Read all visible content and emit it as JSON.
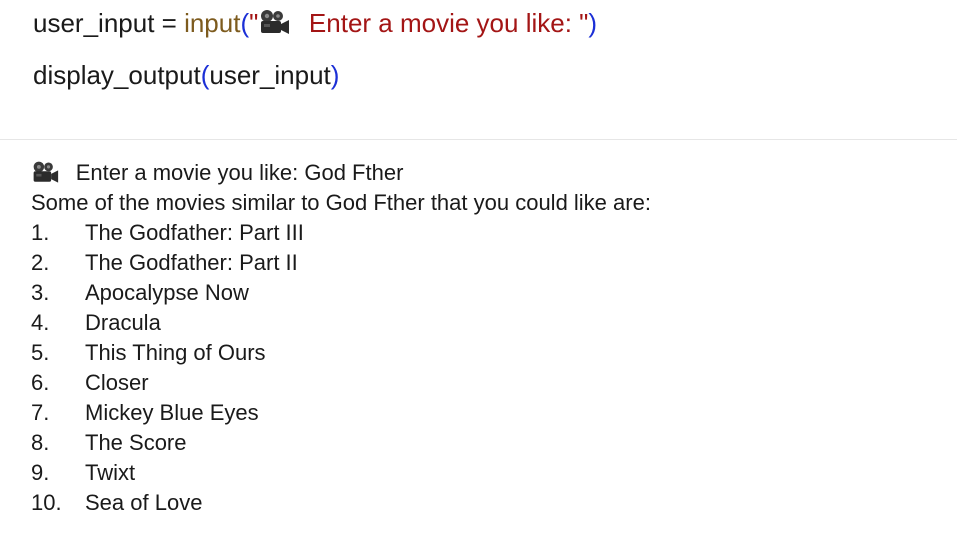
{
  "code": {
    "line1": {
      "var_name": "user_input",
      "operator": " = ",
      "fn_name": "input",
      "open_paren": "(",
      "str_open_quote": "\"",
      "icon": "movie-camera-icon",
      "str_text": " Enter a movie you like: \"",
      "close_paren": ")"
    },
    "line2": {
      "fn_name": "display_output",
      "open_paren": "(",
      "arg": "user_input",
      "close_paren": ")"
    }
  },
  "output": {
    "prompt_icon": "movie-camera-icon",
    "prompt_text": "Enter a movie you like: God Fther",
    "intro": "Some of the movies similar to God Fther that you could like are:",
    "movies": [
      {
        "num": "1.",
        "title": "The Godfather: Part III"
      },
      {
        "num": "2.",
        "title": "The Godfather: Part II"
      },
      {
        "num": "3.",
        "title": "Apocalypse Now"
      },
      {
        "num": "4.",
        "title": "Dracula"
      },
      {
        "num": "5.",
        "title": "This Thing of Ours"
      },
      {
        "num": "6.",
        "title": "Closer"
      },
      {
        "num": "7.",
        "title": "Mickey Blue Eyes"
      },
      {
        "num": "8.",
        "title": "The Score"
      },
      {
        "num": "9.",
        "title": "Twixt"
      },
      {
        "num": "10.",
        "title": "Sea of Love"
      }
    ]
  },
  "colors": {
    "function": "#7d5b1e",
    "paren": "#1b2fd6",
    "string": "#a31515",
    "text": "#1a1a1a",
    "divider": "#e6e6e6"
  }
}
